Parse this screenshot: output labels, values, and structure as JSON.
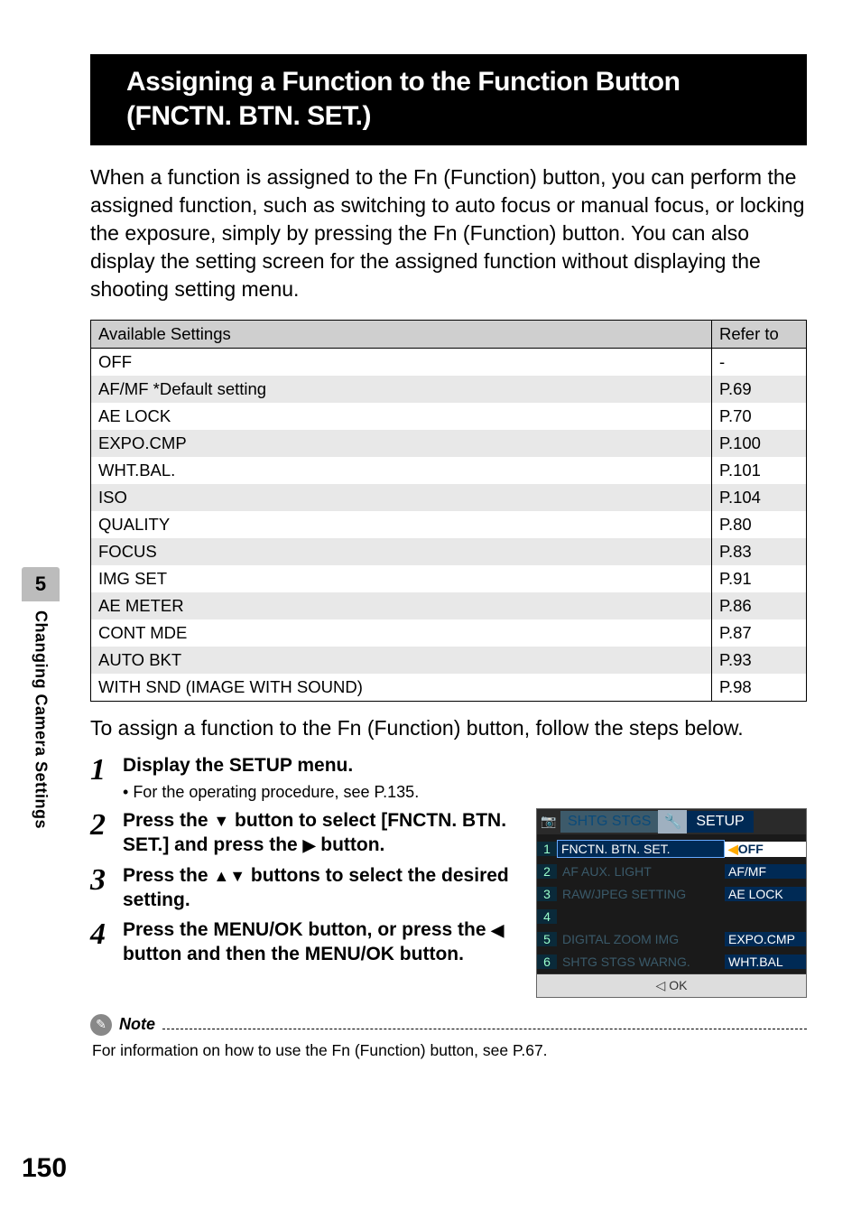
{
  "sideTab": {
    "number": "5",
    "label": "Changing Camera Settings"
  },
  "pageNumber": "150",
  "title": "Assigning a Function to the Function Button (FNCTN. BTN. SET.)",
  "intro": "When a function is assigned to the Fn (Function) button, you can perform the assigned function, such as switching to auto focus or manual focus, or locking the exposure, simply by pressing the Fn (Function) button. You can also display the setting screen for the assigned function without displaying the shooting setting menu.",
  "table": {
    "headers": {
      "col1": "Available Settings",
      "col2": "Refer to"
    },
    "rows": [
      {
        "setting": "OFF",
        "ref": "-"
      },
      {
        "setting": "AF/MF *Default setting",
        "ref": "P.69"
      },
      {
        "setting": "AE LOCK",
        "ref": "P.70"
      },
      {
        "setting": "EXPO.CMP",
        "ref": "P.100"
      },
      {
        "setting": "WHT.BAL.",
        "ref": "P.101"
      },
      {
        "setting": "ISO",
        "ref": "P.104"
      },
      {
        "setting": "QUALITY",
        "ref": "P.80"
      },
      {
        "setting": "FOCUS",
        "ref": "P.83"
      },
      {
        "setting": "IMG SET",
        "ref": "P.91"
      },
      {
        "setting": "AE METER",
        "ref": "P.86"
      },
      {
        "setting": "CONT MDE",
        "ref": "P.87"
      },
      {
        "setting": "AUTO BKT",
        "ref": "P.93"
      },
      {
        "setting": "WITH SND (IMAGE WITH SOUND)",
        "ref": "P.98"
      }
    ]
  },
  "afterTable": "To assign a function to the Fn (Function) button, follow the steps below.",
  "steps": [
    {
      "num": "1",
      "text": "Display the SETUP menu.",
      "sub": "For the operating procedure, see P.135."
    },
    {
      "num": "2",
      "text_parts": [
        "Press the ",
        "▼",
        " button to select [FNCTN. BTN. SET.] and press the ",
        "▶",
        " button."
      ]
    },
    {
      "num": "3",
      "text_parts": [
        "Press the ",
        "▲▼",
        " buttons to select the desired setting."
      ]
    },
    {
      "num": "4",
      "text_parts": [
        "Press the MENU/OK button, or press the ",
        "◀",
        " button and then the MENU/OK button."
      ]
    }
  ],
  "screenshot": {
    "tabs": {
      "left": "SHTG STGS",
      "midIcon": "🔧",
      "right": "SETUP",
      "leftIcon": "📷"
    },
    "rows": [
      {
        "idx": "1",
        "label": "FNCTN. BTN. SET.",
        "val": "OFF",
        "selected": true
      },
      {
        "idx": "2",
        "label": "AF AUX. LIGHT",
        "val": "AF/MF"
      },
      {
        "idx": "3",
        "label": "RAW/JPEG SETTING",
        "val": "AE LOCK"
      },
      {
        "idx": "4",
        "label": "",
        "val": ""
      },
      {
        "idx": "5",
        "label": "DIGITAL ZOOM IMG",
        "val": "EXPO.CMP"
      },
      {
        "idx": "6",
        "label": "SHTG STGS WARNG.",
        "val": "WHT.BAL"
      }
    ],
    "footer": "◁ OK"
  },
  "note": {
    "label": "Note",
    "text": "For information on how to use the Fn (Function) button, see P.67."
  }
}
